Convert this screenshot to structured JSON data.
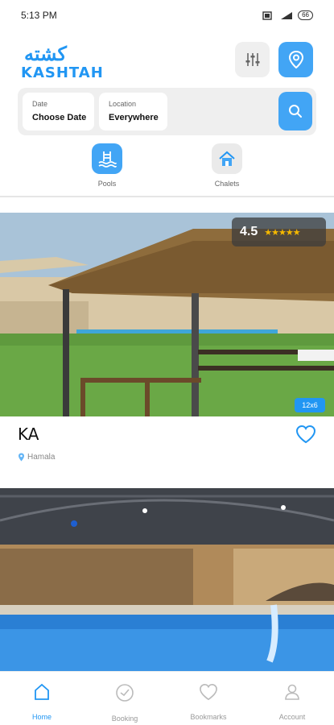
{
  "status": {
    "time": "5:13 PM",
    "battery": "66"
  },
  "header": {
    "logo_ar": "كشته",
    "logo_en": "KASHTAH",
    "filter_icon": "sliders-icon",
    "map_icon": "map-pin-icon"
  },
  "search": {
    "date_label": "Date",
    "date_value": "Choose Date",
    "location_label": "Location",
    "location_value": "Everywhere",
    "search_icon": "search-icon"
  },
  "categories": [
    {
      "label": "Pools",
      "icon": "pool-icon"
    },
    {
      "label": "Chalets",
      "icon": "house-icon"
    }
  ],
  "listings": [
    {
      "title": "KA",
      "location": "Hamala",
      "rating": "4.5",
      "stars": "★★★★★",
      "size": "12x6"
    }
  ],
  "nav": {
    "home": "Home",
    "booking": "Booking",
    "bookmarks": "Bookmarks",
    "account": "Account"
  },
  "colors": {
    "accent": "#42a5f5",
    "brand": "#2196f3",
    "star": "#f5b800"
  }
}
